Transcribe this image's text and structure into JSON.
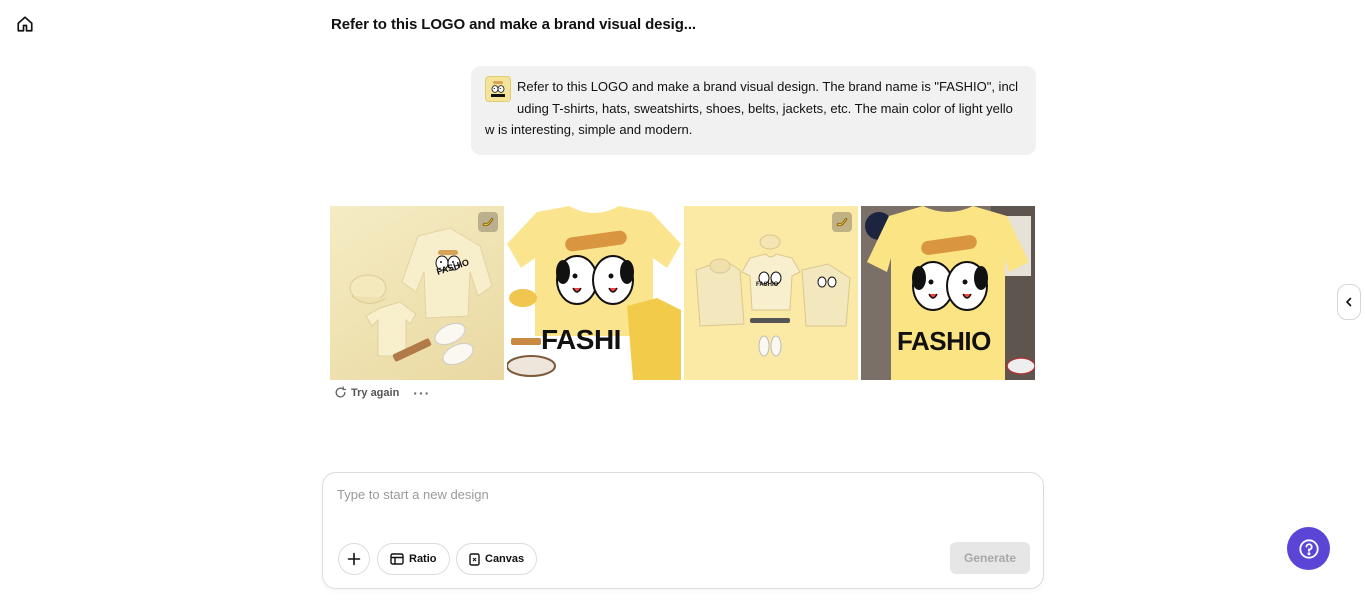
{
  "header": {
    "home_icon": "home-icon",
    "title": "Refer to this LOGO and make a brand visual desig..."
  },
  "message": {
    "text": "Refer to this LOGO and make a brand visual design. The brand name is \"FASHIO\", including T-shirts, hats, sweatshirts, shoes, belts, jackets, etc. The main color of light yellow is interesting, simple and modern.",
    "logo_brand": "FASHIO"
  },
  "gallery": {
    "images": [
      {
        "description": "flat lay sweatshirt cap sneakers belt",
        "brand": "FASHIO",
        "has_badge": true
      },
      {
        "description": "yellow t-shirt jacket cap sneakers",
        "brand": "FASHI",
        "has_badge": false
      },
      {
        "description": "collection hoodie tee sweatshirt cap",
        "brand": "FASHIO",
        "has_badge": true
      },
      {
        "description": "yellow t-shirt on person in store",
        "brand": "FASHIO",
        "has_badge": false
      }
    ]
  },
  "actions": {
    "try_again": "Try again",
    "more": "···"
  },
  "composer": {
    "placeholder": "Type to start a new design",
    "ratio_label": "Ratio",
    "canvas_label": "Canvas",
    "generate_label": "Generate"
  },
  "colors": {
    "accent": "#5b45d6",
    "bubble_bg": "#f1f1f1",
    "brand_yellow": "#fbe9a6"
  }
}
